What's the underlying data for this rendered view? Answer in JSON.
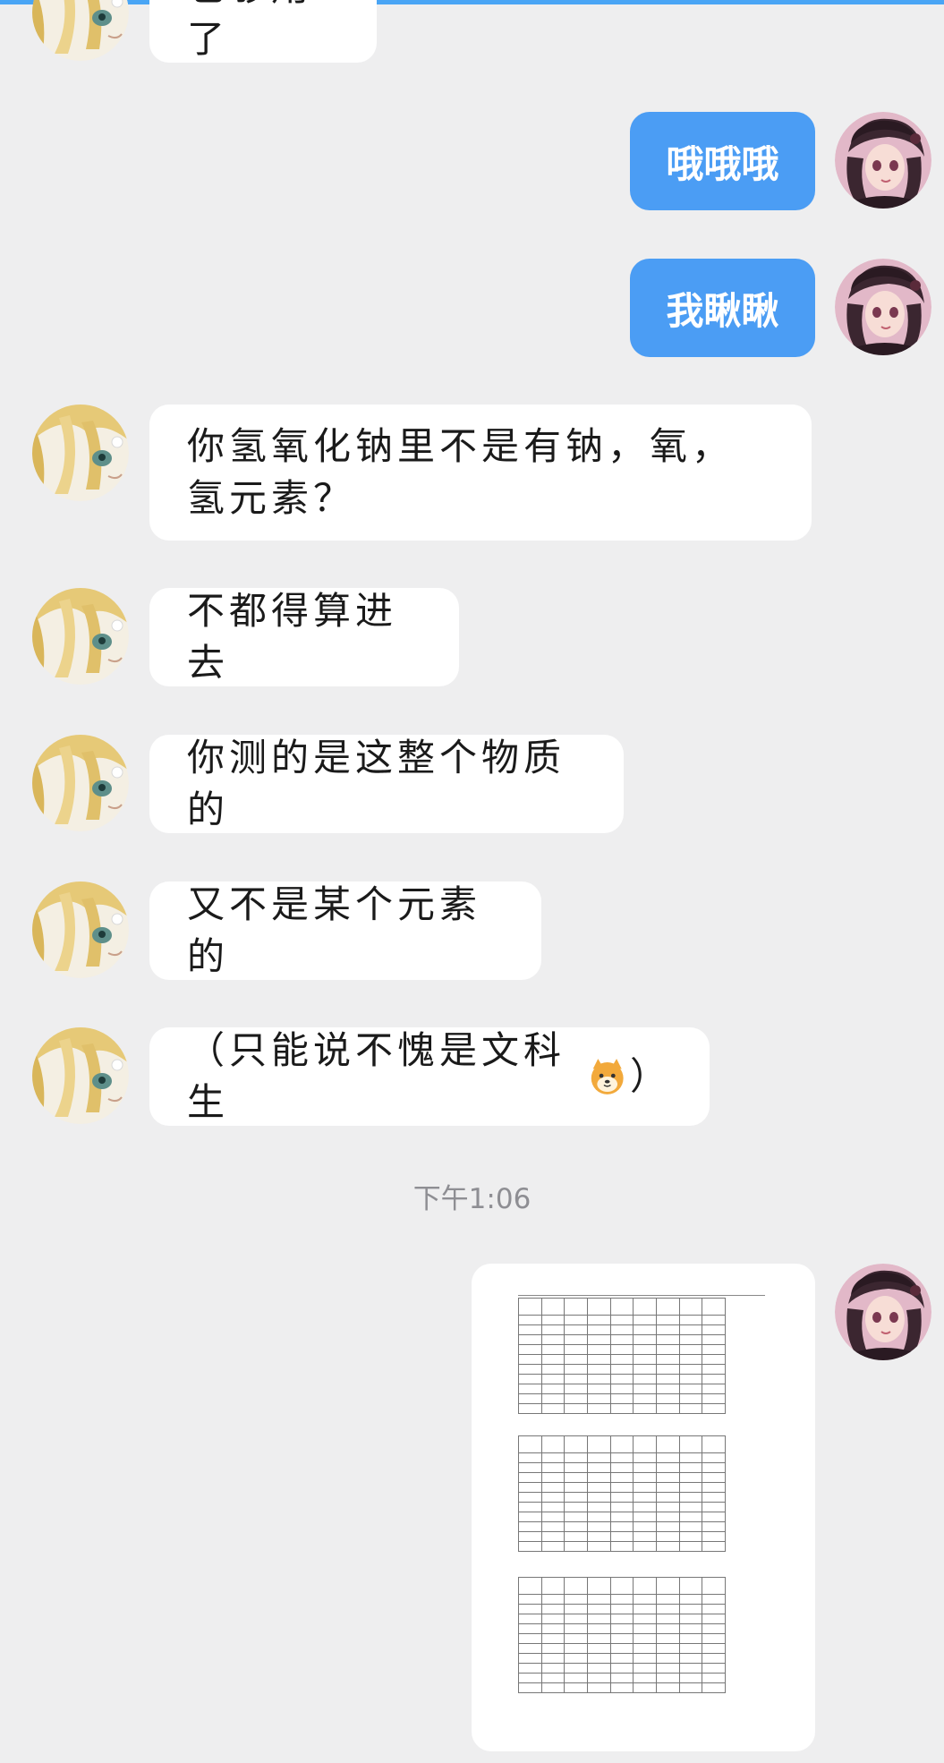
{
  "colors": {
    "background": "#eeeeef",
    "my_bubble": "#4b9df4",
    "friend_bubble": "#ffffff",
    "timestamp_text": "#8e8e93",
    "top_accent": "#49a5f5"
  },
  "messages": [
    {
      "sender": "friend",
      "text": "也够用了"
    },
    {
      "sender": "me",
      "text": "哦哦哦"
    },
    {
      "sender": "me",
      "text": "我瞅瞅"
    },
    {
      "sender": "friend",
      "text": "你氢氧化钠里不是有钠，氧，氢元素？"
    },
    {
      "sender": "friend",
      "text": "不都得算进去"
    },
    {
      "sender": "friend",
      "text": "你测的是这整个物质的"
    },
    {
      "sender": "friend",
      "text": "又不是某个元素的"
    },
    {
      "sender": "friend",
      "text_before": "（只能说不愧是文科生",
      "emoji": "shiba-dog-emoji",
      "text_after": "）"
    }
  ],
  "timestamp": "下午1:06",
  "image_message": {
    "sender": "me",
    "content": "document-table-image"
  },
  "icons": {
    "friend_avatar": "friend-avatar-icon",
    "my_avatar": "my-avatar-icon"
  }
}
